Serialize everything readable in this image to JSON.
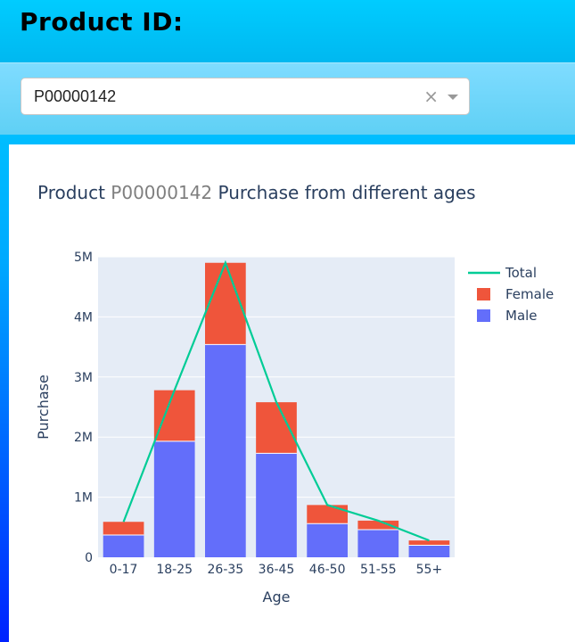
{
  "header": {
    "title": "Product ID:"
  },
  "dropdown": {
    "value": "P00000142",
    "clear_symbol": "×"
  },
  "chart_title": {
    "prefix": "Product ",
    "product_id": "P00000142",
    "suffix": " Purchase from different ages"
  },
  "chart_data": {
    "type": "bar",
    "stacked": true,
    "categories": [
      "0-17",
      "18-25",
      "26-35",
      "36-45",
      "46-50",
      "51-55",
      "55+"
    ],
    "series": [
      {
        "name": "Male",
        "values": [
          370000,
          1930000,
          3540000,
          1730000,
          560000,
          460000,
          200000
        ],
        "color": "#636efa"
      },
      {
        "name": "Female",
        "values": [
          220000,
          850000,
          1360000,
          850000,
          310000,
          150000,
          80000
        ],
        "color": "#ef553b"
      }
    ],
    "line": {
      "name": "Total",
      "values": [
        590000,
        2780000,
        4900000,
        2580000,
        870000,
        610000,
        280000
      ],
      "color": "#00cc96"
    },
    "xlabel": "Age",
    "ylabel": "Purchase",
    "ylim": [
      0,
      5000000
    ],
    "yticks": [
      0,
      1000000,
      2000000,
      3000000,
      4000000,
      5000000
    ],
    "ytick_labels": [
      "0",
      "1M",
      "2M",
      "3M",
      "4M",
      "5M"
    ],
    "legend": [
      "Total",
      "Female",
      "Male"
    ],
    "legend_placement": "top-right",
    "grid": true,
    "plot_bg": "#e5ecf6"
  }
}
